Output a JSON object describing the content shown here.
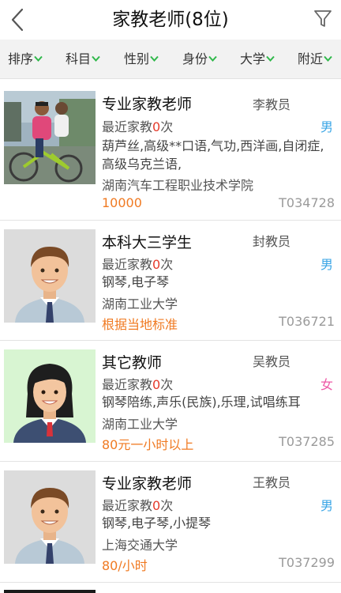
{
  "header": {
    "title": "家教老师(8位)",
    "back_icon": "chevron-left-icon",
    "filter_icon": "funnel-icon"
  },
  "filters": [
    {
      "label": "排序"
    },
    {
      "label": "科目"
    },
    {
      "label": "性别"
    },
    {
      "label": "身份"
    },
    {
      "label": "大学"
    },
    {
      "label": "附近"
    }
  ],
  "colors": {
    "accent_green": "#2fb84a",
    "price_orange": "#f07a22",
    "count_red": "#e53b2b",
    "male_blue": "#3aa6e6",
    "female_pink": "#ee5aa8"
  },
  "teachers": [
    {
      "category": "专业家教老师",
      "name": "李教员",
      "gender": "男",
      "recent_prefix": "最近家教",
      "recent_count": "0",
      "recent_suffix": "次",
      "subjects": "葫芦丝,高级**口语,气功,西洋画,自闭症,高级乌克兰语,",
      "school": "湖南汽车工程职业技术学院",
      "price": "10000",
      "id": "T034728",
      "photo": "cyclist-photo"
    },
    {
      "category": "本科大三学生",
      "name": "封教员",
      "gender": "男",
      "recent_prefix": "最近家教",
      "recent_count": "0",
      "recent_suffix": "次",
      "subjects": "钢琴,电子琴",
      "school": "湖南工业大学",
      "price": "根据当地标准",
      "id": "T036721",
      "photo": "male-avatar"
    },
    {
      "category": "其它教师",
      "name": "吴教员",
      "gender": "女",
      "recent_prefix": "最近家教",
      "recent_count": "0",
      "recent_suffix": "次",
      "subjects": "钢琴陪练,声乐(民族),乐理,试唱练耳",
      "school": "湖南工业大学",
      "price": "80元一小时以上",
      "id": "T037285",
      "photo": "female-avatar"
    },
    {
      "category": "专业家教老师",
      "name": "王教员",
      "gender": "男",
      "recent_prefix": "最近家教",
      "recent_count": "0",
      "recent_suffix": "次",
      "subjects": "钢琴,电子琴,小提琴",
      "school": "上海交通大学",
      "price": "80/小时",
      "id": "T037299",
      "photo": "male-avatar"
    }
  ]
}
